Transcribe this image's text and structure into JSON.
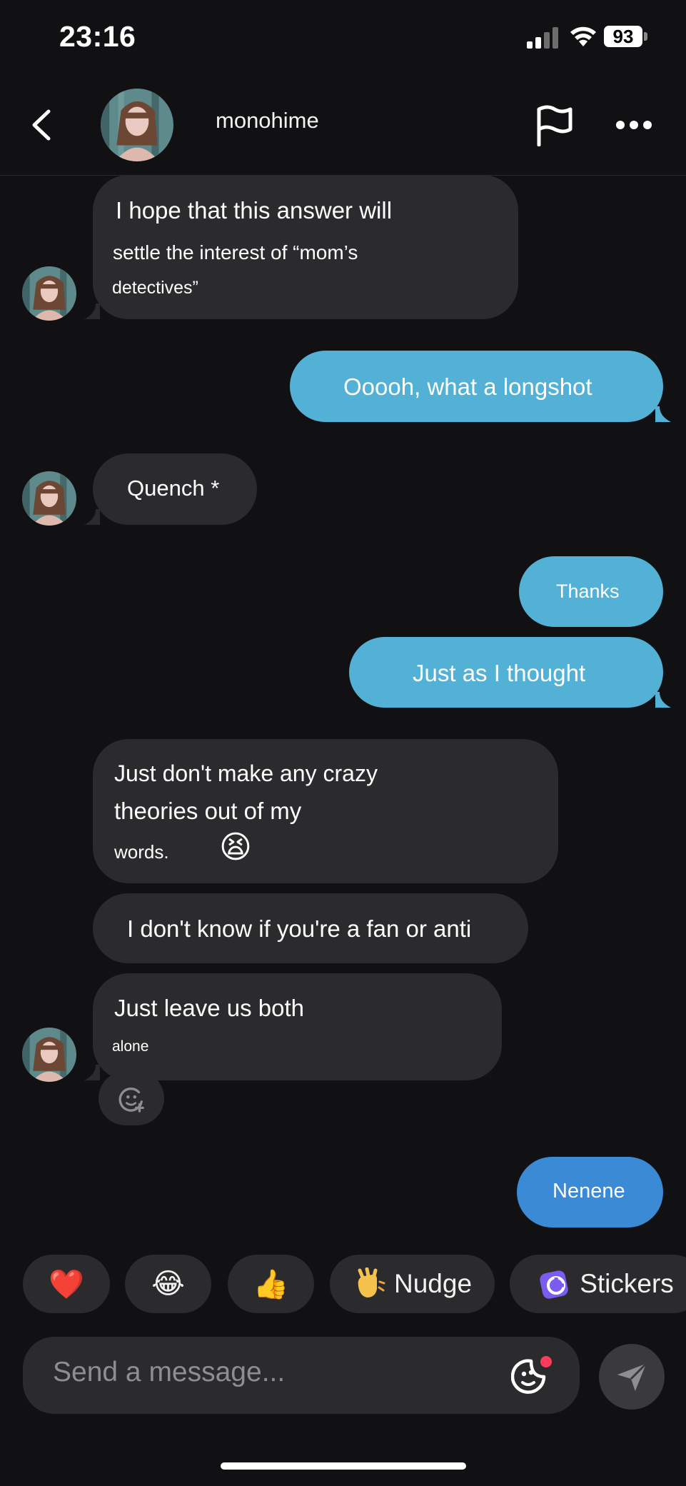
{
  "status_bar": {
    "time": "23:16",
    "battery": "93"
  },
  "header": {
    "contact_name": "monohime"
  },
  "messages": [
    {
      "side": "in",
      "lines": [
        "I hope that this answer will",
        "settle the interest of “mom’s",
        "detectives”"
      ]
    },
    {
      "side": "out",
      "text": "Ooooh, what a longshot"
    },
    {
      "side": "in",
      "text": "Quench *"
    },
    {
      "side": "out",
      "text": "Thanks"
    },
    {
      "side": "out",
      "text": "Just as I thought"
    },
    {
      "side": "in",
      "lines": [
        "Just don't make any crazy",
        "theories out of my",
        "words."
      ],
      "emoji": "😫"
    },
    {
      "side": "in",
      "text": "I don't know if you're a fan or anti"
    },
    {
      "side": "in",
      "lines": [
        "Just leave us both",
        "alone"
      ]
    },
    {
      "side": "out",
      "text": "Nenene"
    }
  ],
  "quick_actions": {
    "heart": "❤️",
    "laugh": "😂",
    "thumbs": "👍",
    "nudge_label": "Nudge",
    "stickers_label": "Stickers"
  },
  "composer": {
    "placeholder": "Send a message..."
  },
  "colors": {
    "background": "#111113",
    "incoming_bubble": "#2b2b2d",
    "outgoing_bubble": "#53b1d6",
    "outgoing_bubble_last": "#3a8ad6",
    "chip": "#2b2b2d"
  }
}
